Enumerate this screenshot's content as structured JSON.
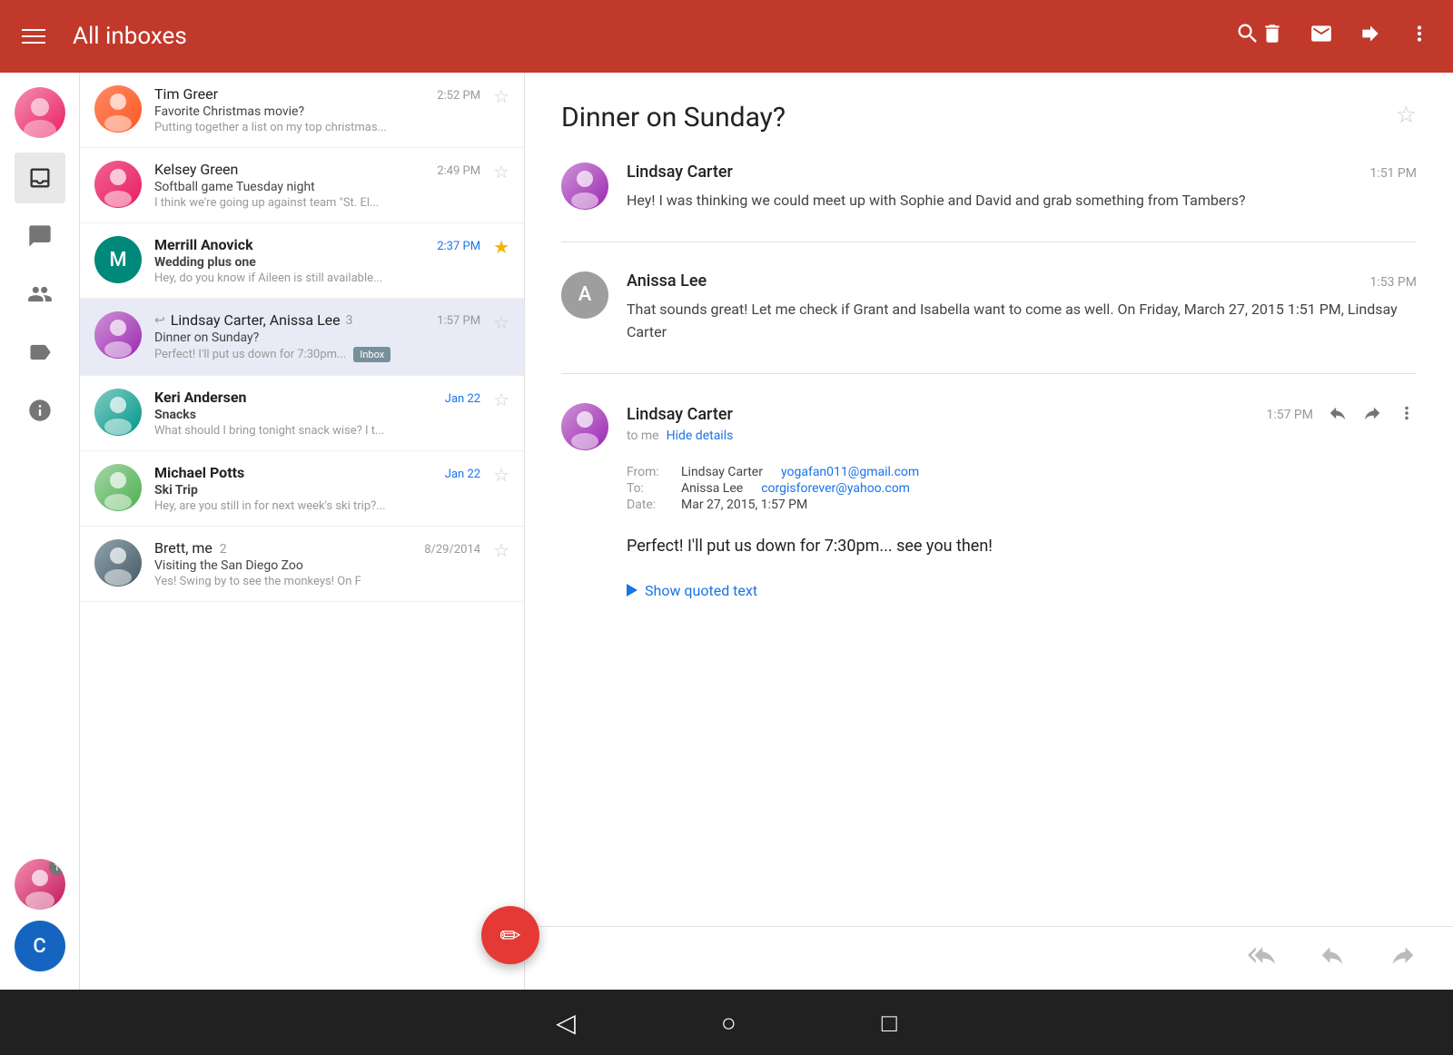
{
  "header": {
    "title": "All inboxes",
    "search_label": "Search"
  },
  "sidebar": {
    "items": [
      {
        "name": "all-inboxes",
        "icon": "inbox"
      },
      {
        "name": "chat",
        "icon": "chat"
      },
      {
        "name": "contacts",
        "icon": "people"
      },
      {
        "name": "labels",
        "icon": "label"
      },
      {
        "name": "info",
        "icon": "info"
      }
    ],
    "bottom_avatars": [
      {
        "name": "user1",
        "badge": "1"
      },
      {
        "name": "user2",
        "letter": "C"
      }
    ]
  },
  "email_list": {
    "items": [
      {
        "id": "tim-greer",
        "sender": "Tim Greer",
        "subject": "Favorite Christmas movie?",
        "preview": "Putting together a list on my top christmas...",
        "time": "2:52 PM",
        "bold": false,
        "starred": false,
        "has_badge": false,
        "avatar_type": "image",
        "avatar_face": "tim"
      },
      {
        "id": "kelsey-green",
        "sender": "Kelsey Green",
        "subject": "Softball game Tuesday night",
        "preview": "I think we're going up against team \"St. El...",
        "time": "2:49 PM",
        "bold": false,
        "starred": false,
        "has_badge": false,
        "avatar_type": "image",
        "avatar_face": "kelsey"
      },
      {
        "id": "merrill-anovick",
        "sender": "Merrill Anovick",
        "subject": "Wedding plus one",
        "preview": "Hey, do you know if Aileen is still available...",
        "time": "2:37 PM",
        "bold": true,
        "starred": true,
        "has_badge": false,
        "avatar_type": "letter",
        "avatar_letter": "M",
        "avatar_color": "#00897b"
      },
      {
        "id": "lindsay-carter",
        "sender": "Lindsay Carter, Anissa Lee",
        "sender_count": "3",
        "subject": "Dinner on Sunday?",
        "preview": "Perfect! I'll put us down for 7:30pm...",
        "time": "1:57 PM",
        "bold": false,
        "starred": false,
        "has_badge": true,
        "badge_text": "Inbox",
        "selected": true,
        "avatar_type": "image",
        "avatar_face": "lindsay",
        "has_reply_icon": true
      },
      {
        "id": "keri-andersen",
        "sender": "Keri Andersen",
        "subject": "Snacks",
        "preview": "What should I bring tonight snack wise? I t...",
        "time": "Jan 22",
        "bold": true,
        "starred": false,
        "has_badge": false,
        "avatar_type": "image",
        "avatar_face": "keri"
      },
      {
        "id": "michael-potts",
        "sender": "Michael Potts",
        "subject": "Ski Trip",
        "preview": "Hey, are you still in for next week's ski trip?...",
        "time": "Jan 22",
        "bold": true,
        "starred": false,
        "has_badge": false,
        "avatar_type": "image",
        "avatar_face": "michael"
      },
      {
        "id": "brett-me",
        "sender": "Brett, me",
        "sender_count": "2",
        "subject": "Visiting the San Diego Zoo",
        "preview": "Yes! Swing by to see the monkeys! On F",
        "time": "8/29/2014",
        "bold": false,
        "starred": false,
        "has_badge": false,
        "avatar_type": "image",
        "avatar_face": "brett"
      }
    ]
  },
  "email_detail": {
    "title": "Dinner on Sunday?",
    "messages": [
      {
        "id": "lindsay-msg1",
        "sender": "Lindsay Carter",
        "time": "1:51 PM",
        "body": "Hey! I was thinking we could meet up with Sophie and David and grab something from Tambers?",
        "avatar_type": "image",
        "avatar_face": "lindsay"
      },
      {
        "id": "anissa-msg",
        "sender": "Anissa Lee",
        "time": "1:53 PM",
        "body": "That sounds great! Let me check if Grant and Isabella want to come as well. On Friday, March 27, 2015 1:51 PM, Lindsay Carter",
        "avatar_type": "letter",
        "avatar_letter": "A",
        "avatar_color": "#9e9e9e"
      }
    ],
    "reply": {
      "sender": "Lindsay Carter",
      "to": "to me",
      "hide_details_label": "Hide details",
      "time": "1:57 PM",
      "meta": {
        "from_label": "From:",
        "from_name": "Lindsay Carter",
        "from_email": "yogafan011@gmail.com",
        "to_label": "To:",
        "to_name": "Anissa Lee",
        "to_email": "corgisforever@yahoo.com",
        "date_label": "Date:",
        "date_value": "Mar 27, 2015, 1:57 PM"
      },
      "body": "Perfect! I'll put us down for 7:30pm... see you then!",
      "show_quoted_text": "Show quoted text",
      "avatar_type": "image",
      "avatar_face": "lindsay"
    }
  },
  "nav": {
    "back_icon": "◁",
    "home_icon": "○",
    "recent_icon": "□"
  },
  "fab": {
    "icon": "✏"
  }
}
